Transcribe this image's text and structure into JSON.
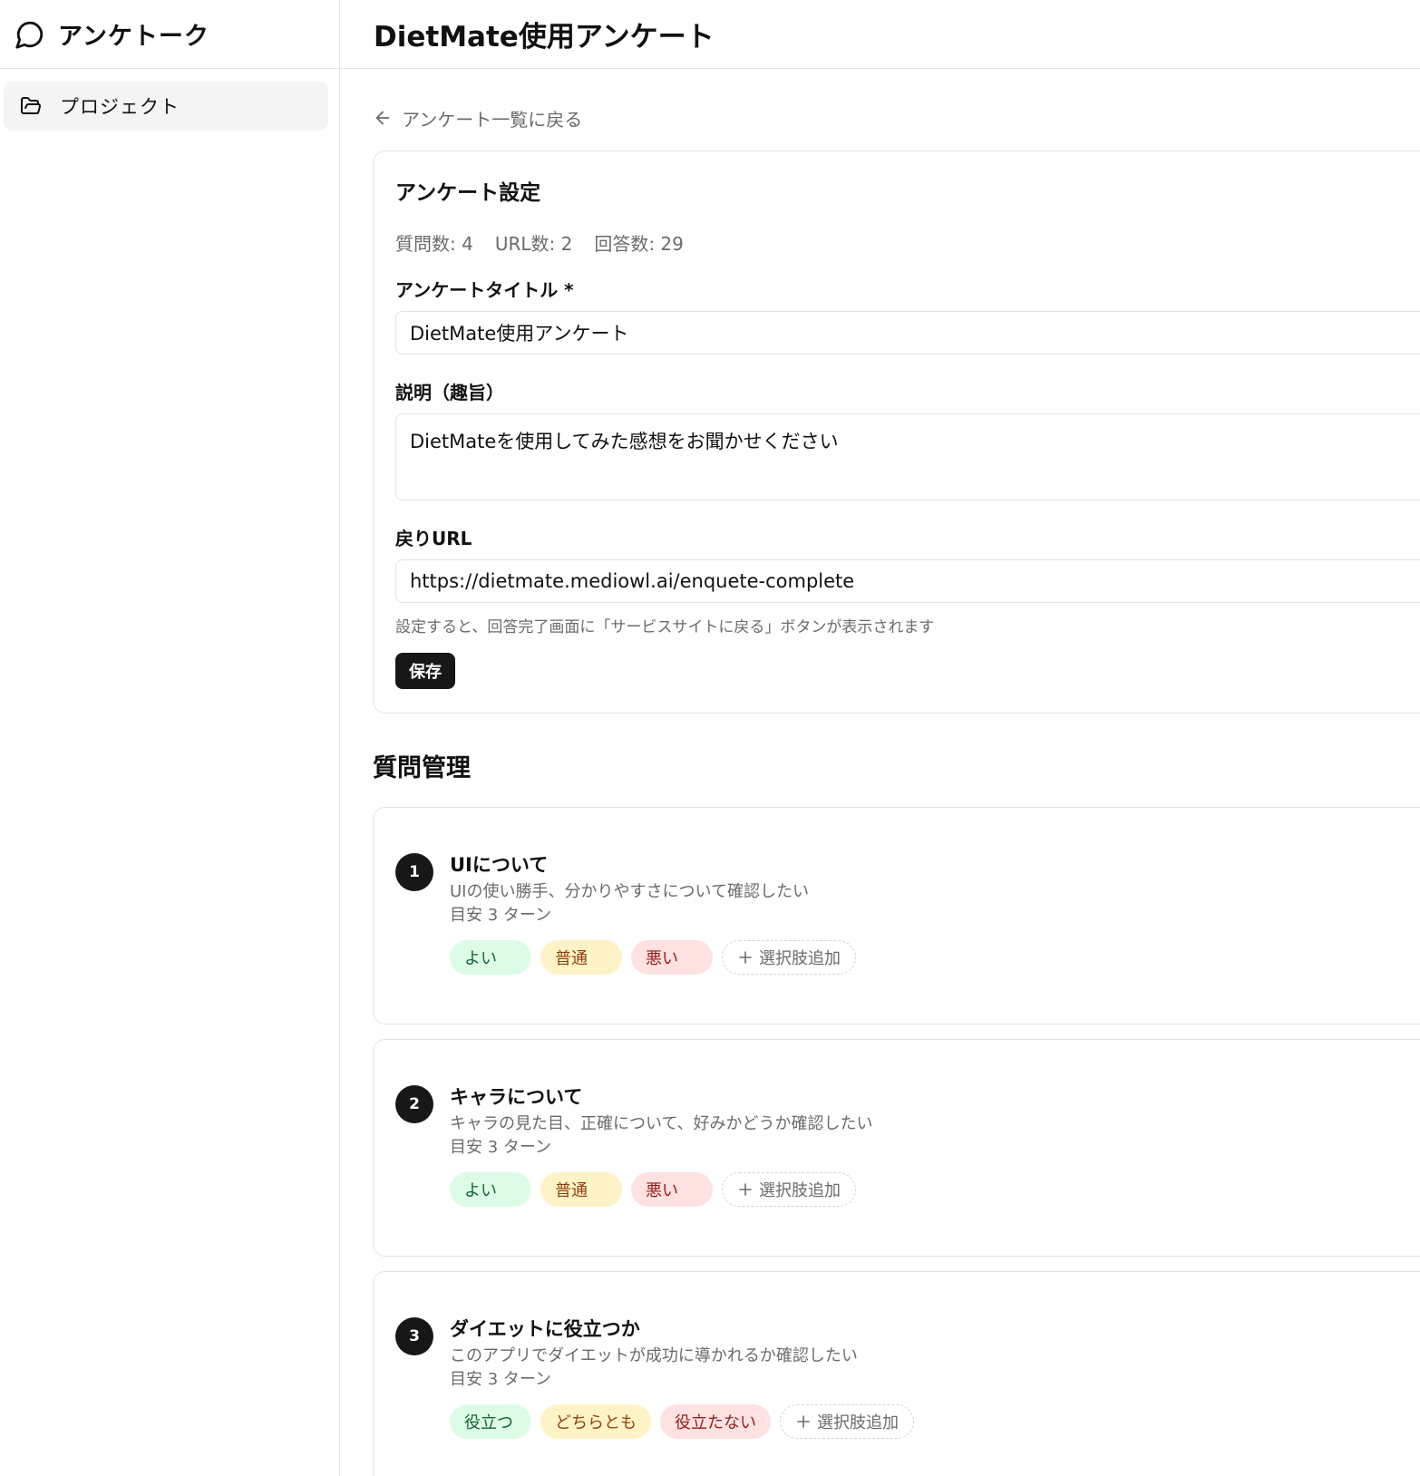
{
  "sidebar": {
    "brand_title": "アンケトーク",
    "nav": [
      {
        "label": "プロジェクト",
        "icon": "folder-icon"
      }
    ]
  },
  "header": {
    "title": "DietMate使用アンケート"
  },
  "back_link": "アンケート一覧に戻る",
  "settings": {
    "title": "アンケート設定",
    "stats": {
      "questions": "質問数: 4",
      "urls": "URL数: 2",
      "answers": "回答数: 29"
    },
    "title_label": "アンケートタイトル *",
    "title_value": "DietMate使用アンケート",
    "description_label": "説明（趣旨）",
    "description_value": "DietMateを使用してみた感想をお聞かせください",
    "return_url_label": "戻りURL",
    "return_url_value": "https://dietmate.mediowl.ai/enquete-complete",
    "hint": "設定すると、回答完了画面に「サービスサイトに戻る」ボタンが表示されます",
    "save_label": "保存"
  },
  "questions_section": {
    "title": "質問管理",
    "add_option_label": "選択肢追加",
    "items": [
      {
        "number": "1",
        "title": "UIについて",
        "description": "UIの使い勝手、分かりやすさについて確認したい",
        "turns": "目安 3 ターン",
        "options": [
          "よい",
          "普通",
          "悪い"
        ]
      },
      {
        "number": "2",
        "title": "キャラについて",
        "description": "キャラの見た目、正確について、好みかどうか確認したい",
        "turns": "目安 3 ターン",
        "options": [
          "よい",
          "普通",
          "悪い"
        ]
      },
      {
        "number": "3",
        "title": "ダイエットに役立つか",
        "description": "このアプリでダイエットが成功に導かれるか確認したい",
        "turns": "目安 3 ターン",
        "options": [
          "役立つ",
          "どちらとも",
          "役立たない"
        ]
      }
    ]
  },
  "colors": {
    "option_good_bg": "#dcfce7",
    "option_mid_bg": "#fef3c7",
    "option_bad_bg": "#fee2e2",
    "primary_button": "#171717"
  }
}
